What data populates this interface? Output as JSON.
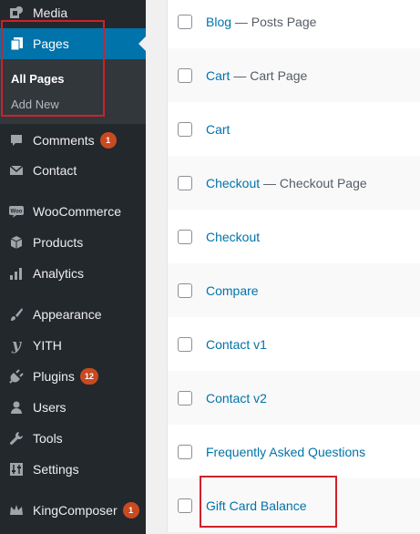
{
  "sidebar": {
    "media": {
      "label": "Media",
      "icon": "media-icon"
    },
    "pages": {
      "label": "Pages",
      "icon": "pages-icon"
    },
    "pages_sub": {
      "all_pages": "All Pages",
      "add_new": "Add New"
    },
    "comments": {
      "label": "Comments",
      "badge": "1",
      "icon": "comments-icon"
    },
    "contact": {
      "label": "Contact",
      "icon": "envelope-icon"
    },
    "woocommerce": {
      "label": "WooCommerce",
      "icon": "woocommerce-icon"
    },
    "products": {
      "label": "Products",
      "icon": "box-icon"
    },
    "analytics": {
      "label": "Analytics",
      "icon": "bar-chart-icon"
    },
    "appearance": {
      "label": "Appearance",
      "icon": "paintbrush-icon"
    },
    "yith": {
      "label": "YITH",
      "icon": "yith-icon"
    },
    "plugins": {
      "label": "Plugins",
      "badge": "12",
      "icon": "plug-icon"
    },
    "users": {
      "label": "Users",
      "icon": "user-icon"
    },
    "tools": {
      "label": "Tools",
      "icon": "wrench-icon"
    },
    "settings": {
      "label": "Settings",
      "icon": "sliders-icon"
    },
    "kingcomposer": {
      "label": "KingComposer",
      "badge": "1",
      "icon": "kingcomposer-icon"
    }
  },
  "pages_list": [
    {
      "title": "Blog",
      "state": "— Posts Page"
    },
    {
      "title": "Cart",
      "state": "— Cart Page"
    },
    {
      "title": "Cart",
      "state": ""
    },
    {
      "title": "Checkout",
      "state": "— Checkout Page"
    },
    {
      "title": "Checkout",
      "state": ""
    },
    {
      "title": "Compare",
      "state": ""
    },
    {
      "title": "Contact v1",
      "state": ""
    },
    {
      "title": "Contact v2",
      "state": ""
    },
    {
      "title": "Frequently Asked Questions",
      "state": ""
    },
    {
      "title": "Gift Card Balance",
      "state": ""
    }
  ],
  "colors": {
    "sidebar_bg": "#23282d",
    "active": "#0073aa",
    "link": "#0073aa",
    "badge": "#ca4a1f",
    "highlight": "#d0202a"
  }
}
